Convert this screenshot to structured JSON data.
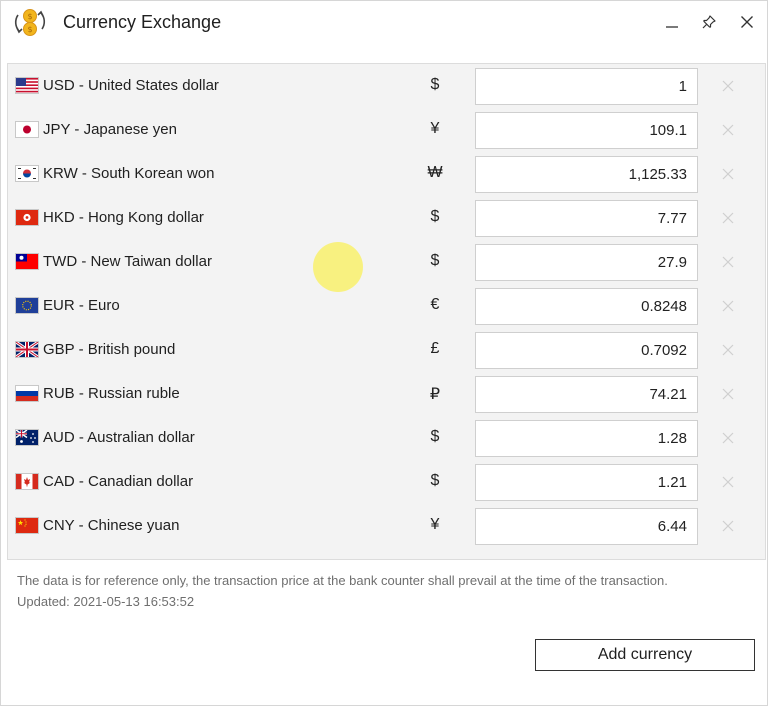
{
  "window": {
    "title": "Currency Exchange"
  },
  "titlebar": {
    "minimize_icon": "minimize-icon",
    "pin_icon": "pin-icon",
    "close_icon": "close-icon"
  },
  "currencies": [
    {
      "flag": "us-flag-icon",
      "label": "USD - United States dollar",
      "symbol": "$",
      "value": "1"
    },
    {
      "flag": "jp-flag-icon",
      "label": "JPY - Japanese yen",
      "symbol": "¥",
      "value": "109.1"
    },
    {
      "flag": "kr-flag-icon",
      "label": "KRW - South Korean won",
      "symbol": "₩",
      "value": "1,125.33"
    },
    {
      "flag": "hk-flag-icon",
      "label": "HKD - Hong Kong dollar",
      "symbol": "$",
      "value": "7.77"
    },
    {
      "flag": "tw-flag-icon",
      "label": "TWD - New Taiwan dollar",
      "symbol": "$",
      "value": "27.9"
    },
    {
      "flag": "eu-flag-icon",
      "label": "EUR - Euro",
      "symbol": "€",
      "value": "0.8248"
    },
    {
      "flag": "gb-flag-icon",
      "label": "GBP - British pound",
      "symbol": "£",
      "value": "0.7092"
    },
    {
      "flag": "ru-flag-icon",
      "label": "RUB - Russian ruble",
      "symbol": "₽",
      "value": "74.21"
    },
    {
      "flag": "au-flag-icon",
      "label": "AUD - Australian dollar",
      "symbol": "$",
      "value": "1.28"
    },
    {
      "flag": "ca-flag-icon",
      "label": "CAD - Canadian dollar",
      "symbol": "$",
      "value": "1.21"
    },
    {
      "flag": "cn-flag-icon",
      "label": "CNY - Chinese yuan",
      "symbol": "¥",
      "value": "6.44"
    }
  ],
  "footer": {
    "note": "The data is for reference only, the transaction price at the bank counter shall prevail at the time of the transaction.",
    "updated": "Updated: 2021-05-13 16:53:52",
    "add_button": "Add currency"
  },
  "colors": {
    "panel_bg": "#f3f3f3",
    "cursor_highlight": "#f7ec5a",
    "coin_gold": "#f2b51c"
  }
}
